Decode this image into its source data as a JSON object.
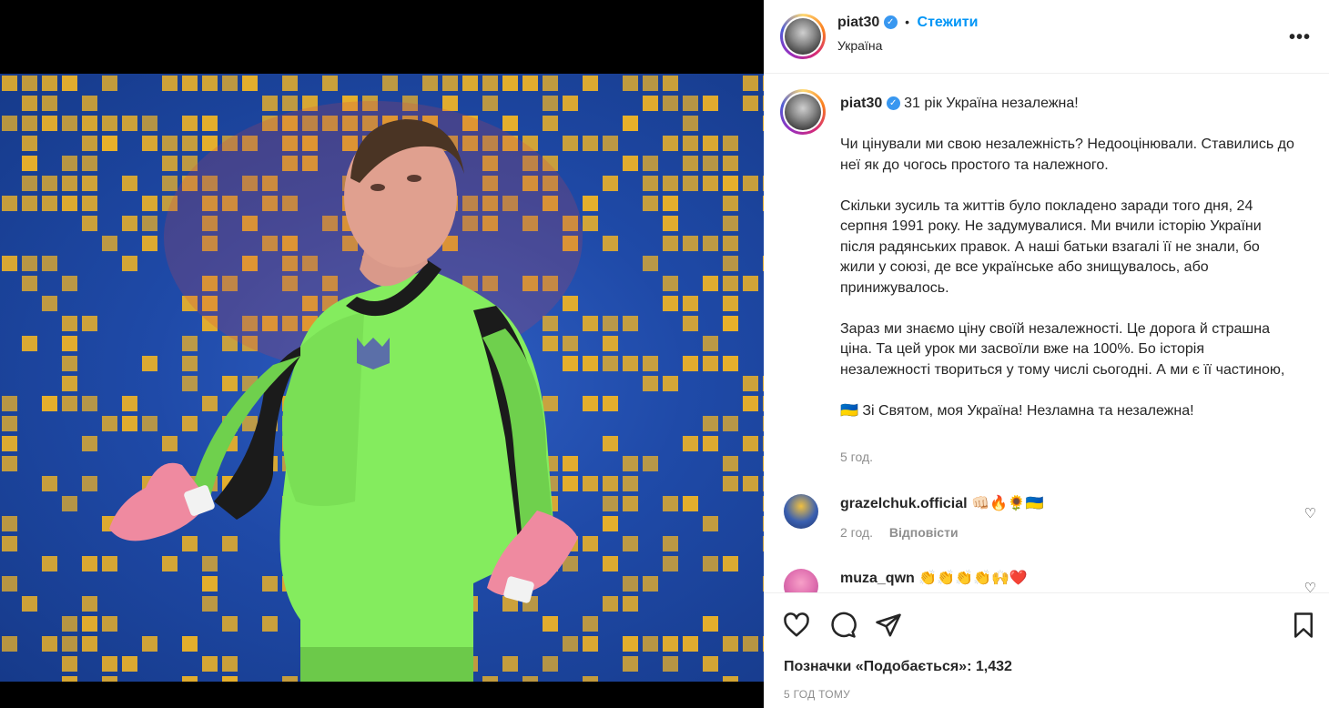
{
  "post": {
    "username": "piat30",
    "follow_label": "Стежити",
    "separator": "•",
    "location": "Україна",
    "more_label": "•••"
  },
  "caption": {
    "username": "piat30",
    "first_line": "31 рік Україна незалежна!",
    "paragraphs": [
      "Чи цінували ми свою незалежність? Недооцінювали. Ставились до неї як до чогось простого та належного.",
      "Скільки зусиль та життів було покладено заради того дня, 24 серпня 1991 року. Не задумувалися. Ми вчили історію України після радянських правок. А наші батьки взагалі її не знали, бо жили у союзі, де все українське або знищувалось, або принижувалось.",
      "Зараз ми знаємо ціну своїй незалежності. Це дорога й страшна ціна. Та цей урок ми засвоїли вже на 100%. Бо історія незалежності твориться у тому числі сьогодні. А ми є її частиною,",
      "🇺🇦 Зі Святом, моя Україна! Незламна та незалежна!"
    ],
    "time": "5 год."
  },
  "comments": [
    {
      "username": "grazelchuk.official",
      "text": "👊🏻🔥🌻🇺🇦",
      "time": "2 год.",
      "reply_label": "Відповісти"
    },
    {
      "username": "muza_qwn",
      "text": "👏👏👏👏🙌❤️"
    }
  ],
  "stats": {
    "likes_label": "Позначки «Подобається»: 1,432",
    "post_time": "5 ГОД ТОМУ"
  },
  "colors": {
    "accent": "#0095f6",
    "verified": "#3897f0",
    "muted": "#8e8e8e",
    "photo_blue": "#1f4aa8",
    "photo_yellow": "#e8b02a",
    "shirt_green": "#8ef06a"
  }
}
